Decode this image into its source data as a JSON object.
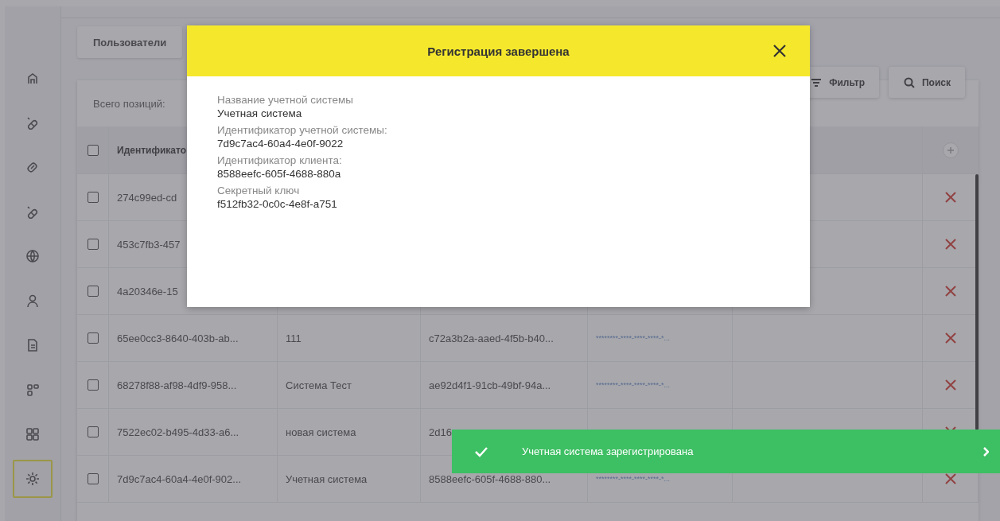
{
  "sidebar": {
    "items": [
      {
        "kind": "home",
        "selected": false
      },
      {
        "kind": "pill",
        "selected": false
      },
      {
        "kind": "link",
        "selected": false
      },
      {
        "kind": "pill",
        "selected": false
      },
      {
        "kind": "globe",
        "selected": false
      },
      {
        "kind": "user",
        "selected": false
      },
      {
        "kind": "document",
        "selected": false
      },
      {
        "kind": "blocks",
        "selected": false
      },
      {
        "kind": "grid",
        "selected": false
      },
      {
        "kind": "settings",
        "selected": true
      }
    ]
  },
  "nav_button": {
    "label": "Пользователи"
  },
  "toolbar": {
    "buttons": [
      {
        "kind": "filter",
        "label": "Фильтр"
      },
      {
        "kind": "search",
        "label": "Поиск"
      }
    ]
  },
  "table": {
    "total": "Всего позиций:",
    "header": {
      "checked": false,
      "column_1": "Идентификато"
    },
    "rows": [
      {
        "checked": false,
        "id": "274c99ed-cd"
      },
      {
        "checked": false,
        "id": "453c7fb3-457"
      },
      {
        "checked": false,
        "id": "4a20346e-15"
      },
      {
        "checked": false,
        "id": "65ee0cc3-8640-403b-ab...",
        "name": "111",
        "client_id": "c72a3b2a-aaed-4f5b-b40...",
        "secret": "********-****-****-****-*..."
      },
      {
        "checked": false,
        "id": "68278f88-af98-4df9-958...",
        "name": "Система Тест",
        "client_id": "ae92d4f1-91cb-49bf-94a...",
        "secret": "********-****-****-****-*..."
      },
      {
        "checked": false,
        "id": "7522ec02-b495-4d33-a6...",
        "name": "новая система",
        "client_id": "2d16"
      },
      {
        "checked": false,
        "id": "7d9c7ac4-60a4-4e0f-902...",
        "name": "Учетная система",
        "client_id": "8588eefc-605f-4688-880...",
        "secret": "********-****-****-****-*..."
      }
    ]
  },
  "modal": {
    "title": "Регистрация завершена",
    "fields": [
      {
        "label": "Название учетной системы",
        "value": "Учетная система"
      },
      {
        "label": "Идентификатор учетной системы:",
        "value": "7d9c7ac4-60a4-4e0f-9022"
      },
      {
        "label": "Идентификатор клиента:",
        "value": "8588eefc-605f-4688-880a"
      },
      {
        "label": "Секретный ключ",
        "value": "f512fb32-0c0c-4e8f-a751"
      }
    ]
  },
  "toast": {
    "message": "Учетная система зарегистрирована"
  }
}
